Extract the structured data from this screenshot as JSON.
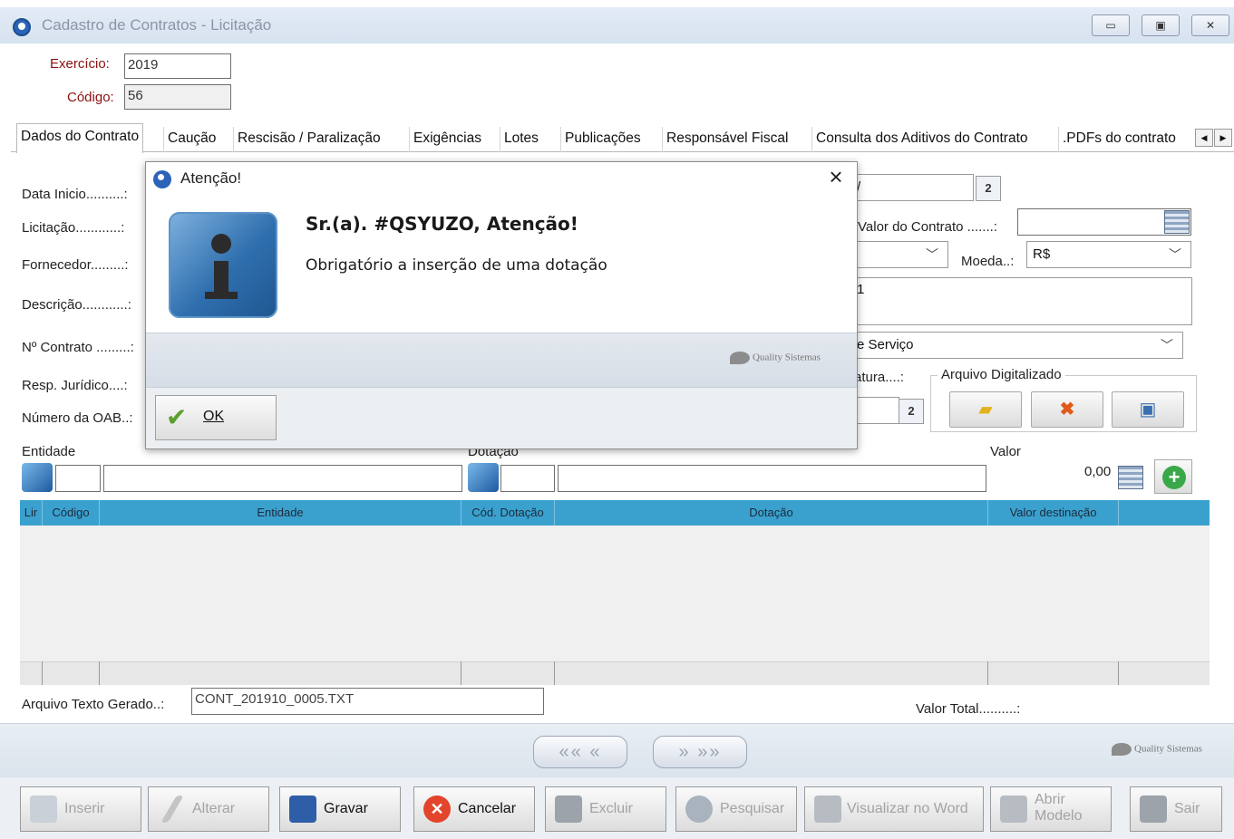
{
  "window": {
    "title": "Cadastro de Contratos  -  Licitação",
    "controls": [
      "▭",
      "▣",
      "✕"
    ]
  },
  "header": {
    "exercicio_label": "Exercício:",
    "exercicio_value": "2019",
    "codigo_label": "Código:",
    "codigo_value": "56"
  },
  "tabs": [
    "Dados do Contrato",
    "Caução",
    "Rescisão / Paralização",
    "Exigências",
    "Lotes",
    "Publicações",
    "Responsável Fiscal",
    "Consulta dos Aditivos do Contrato",
    ".PDFs do contrato"
  ],
  "form": {
    "data_inicio_label": "Data Inicio..........:",
    "licitacao_label": "Licitação............:",
    "fornecedor_label": "Fornecedor.........:",
    "descricao_label": "Descrição............:",
    "n_contrato_label": "Nº Contrato .........:",
    "resp_juridico_label": "Resp. Jurídico....:",
    "numero_oab_label": "Número da OAB..:",
    "valor_contrato_label": "Valor do Contrato .......:",
    "moeda_label": "Moeda..:",
    "moeda_value": "R$",
    "tipo_value": "e Serviço",
    "assinatura_label": "atura....:",
    "arquivo_digitalizado_label": "Arquivo Digitalizado",
    "slash": "/",
    "desc_tick": "1",
    "cal_glyph": "2"
  },
  "entidade_section": {
    "entidade_label": "Entidade",
    "dotacao_label": "Dotação",
    "valor_label": "Valor",
    "valor_value": "0,00"
  },
  "grid": {
    "columns": [
      "Lir",
      "Código",
      "Entidade",
      "Cód. Dotação",
      "Dotação",
      "Valor destinação"
    ]
  },
  "footer_fields": {
    "arquivo_texto_label": "Arquivo Texto Gerado..:",
    "arquivo_texto_value": "CONT_201910_0005.TXT",
    "valor_total_label": "Valor Total..........:"
  },
  "navigation": {
    "prev_glyph": "«« «",
    "next_glyph": "» »»"
  },
  "logo_text": "Quality Sistemas",
  "toolbar": {
    "inserir": "Inserir",
    "alterar": "Alterar",
    "gravar": "Gravar",
    "cancelar": "Cancelar",
    "excluir": "Excluir",
    "pesquisar": "Pesquisar",
    "visualizar_word": "Visualizar no Word",
    "abrir_modelo": "Abrir Modelo",
    "sair": "Sair"
  },
  "dialog": {
    "title": "Atenção!",
    "close_glyph": "×",
    "heading": "Sr.(a). #QSYUZO, Atenção!",
    "message": "Obrigatório a inserção de uma dotação",
    "ok_label": "OK",
    "ok_glyph": "✔"
  },
  "colors": {
    "grid_header": "#3aa1cf",
    "label_red": "#8b1010",
    "accent_blue": "#2a64b8"
  }
}
